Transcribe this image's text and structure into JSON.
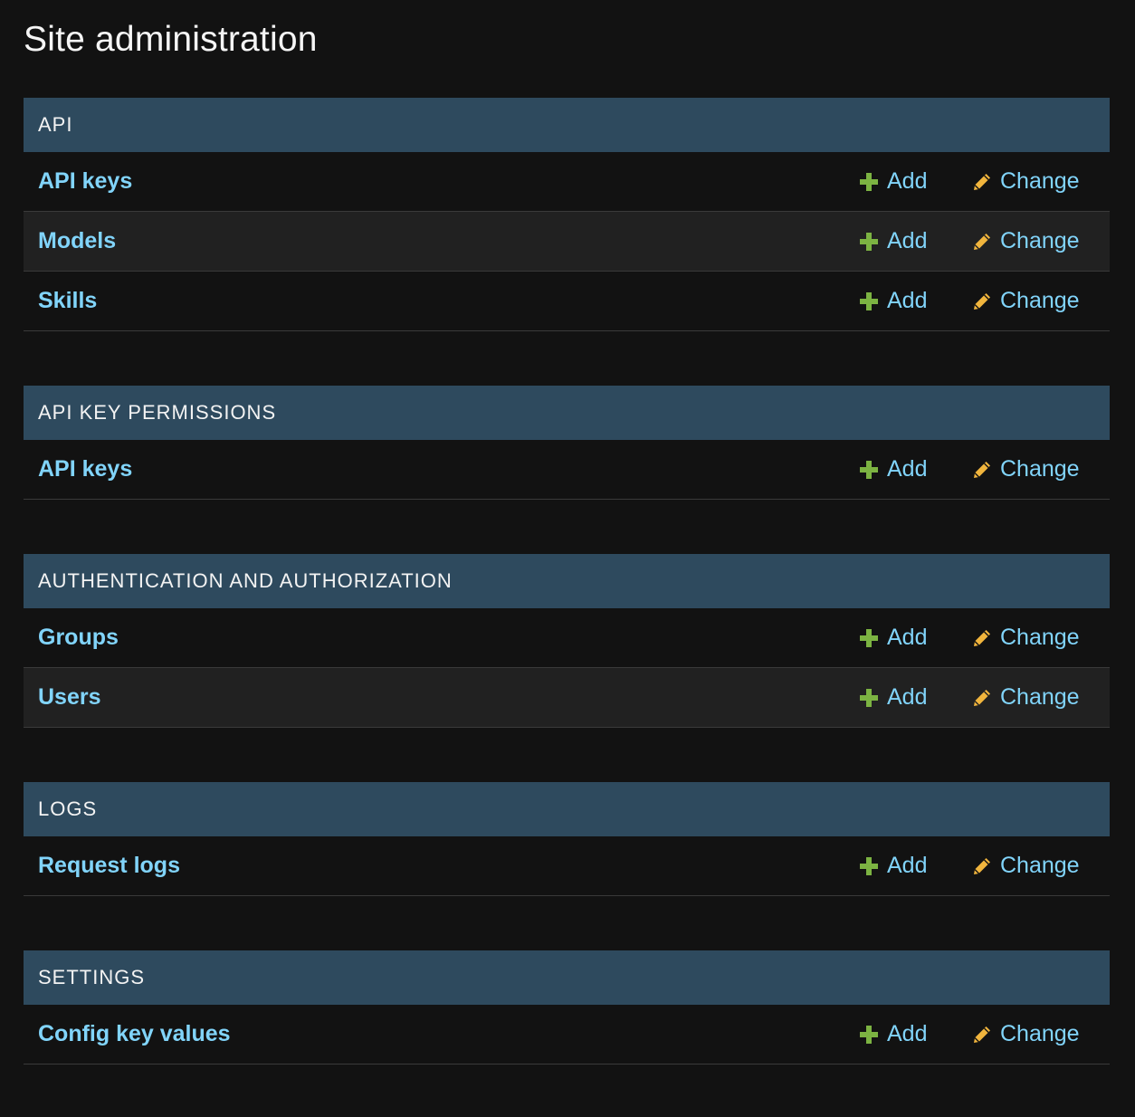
{
  "page": {
    "title": "Site administration"
  },
  "colors": {
    "background": "#121212",
    "caption_bg": "#2e4a5e",
    "link": "#81d4fa",
    "add_icon": "#7cb342",
    "change_icon": "#f1b53d"
  },
  "icons": {
    "add": "plus-icon",
    "change": "pencil-icon"
  },
  "actions": {
    "add_label": "Add",
    "change_label": "Change"
  },
  "modules": [
    {
      "caption": "API",
      "models": [
        {
          "name": "API keys"
        },
        {
          "name": "Models"
        },
        {
          "name": "Skills"
        }
      ]
    },
    {
      "caption": "API KEY PERMISSIONS",
      "models": [
        {
          "name": "API keys"
        }
      ]
    },
    {
      "caption": "AUTHENTICATION AND AUTHORIZATION",
      "models": [
        {
          "name": "Groups"
        },
        {
          "name": "Users"
        }
      ]
    },
    {
      "caption": "LOGS",
      "models": [
        {
          "name": "Request logs"
        }
      ]
    },
    {
      "caption": "SETTINGS",
      "models": [
        {
          "name": "Config key values"
        }
      ]
    }
  ]
}
